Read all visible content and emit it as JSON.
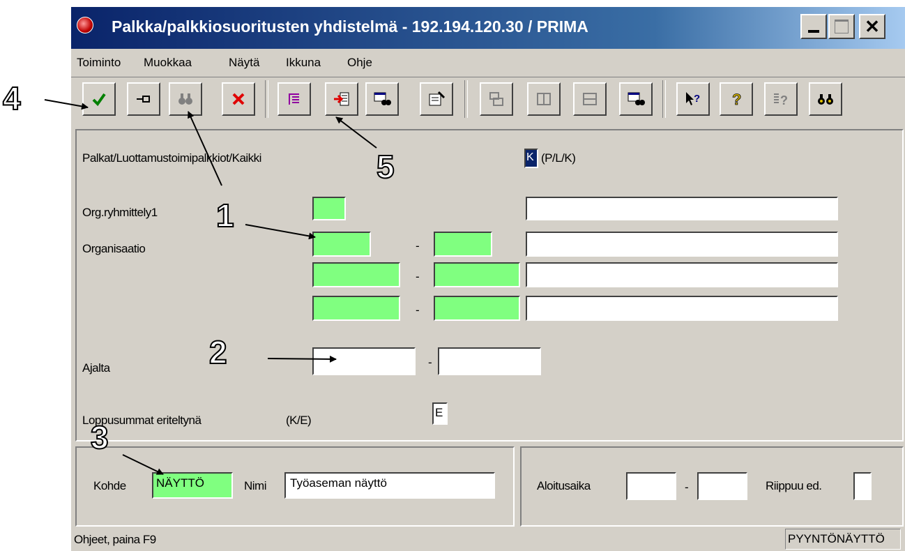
{
  "window": {
    "title": "Palkka/palkkiosuoritusten yhdistelmä - 192.194.120.30 / PRIMA",
    "controls": [
      "_",
      "□",
      "✕"
    ]
  },
  "menu": [
    "Toiminto",
    "Muokkaa",
    "Näytä",
    "Ikkuna",
    "Ohje"
  ],
  "toolbar_icons": [
    "checkmark-icon",
    "pin-icon",
    "binoculars-icon",
    "delete-icon",
    "list-icon",
    "import-icon",
    "window-search-icon",
    "properties-icon",
    "cascade-icon",
    "tile-vertical-icon",
    "tile-horizontal-icon",
    "window-find-icon",
    "context-help-icon",
    "help-icon",
    "help-index-icon",
    "find-icon"
  ],
  "form": {
    "palkat_label": "Palkat/Luottamustoimipalkkiot/Kaikki",
    "palkat_value": "K",
    "palkat_hint": "(P/L/K)",
    "org_ryhmittely_label": "Org.ryhmittely1",
    "organisaatio_label": "Organisaatio",
    "ajalta_label": "Ajalta",
    "loppusummat_label": "Loppusummat eriteltynä",
    "loppusummat_hint": "(K/E)",
    "loppusummat_value": "E",
    "range_separator": "-"
  },
  "bottom": {
    "kohde_label": "Kohde",
    "kohde_value": "NÄYTTÖ",
    "nimi_label": "Nimi",
    "nimi_value": "Työaseman näyttö",
    "aloitusaika_label": "Aloitusaika",
    "riippuu_label": "Riippuu ed."
  },
  "status": {
    "left": "Ohjeet, paina F9",
    "right": "PYYNTÖNÄYTTÖ"
  },
  "callouts": [
    "1",
    "2",
    "3",
    "4",
    "5"
  ],
  "colors": {
    "title_start": "#0a246a",
    "title_end": "#a6caf0",
    "field_green": "#80ff80",
    "window_bg": "#d4d0c8"
  }
}
